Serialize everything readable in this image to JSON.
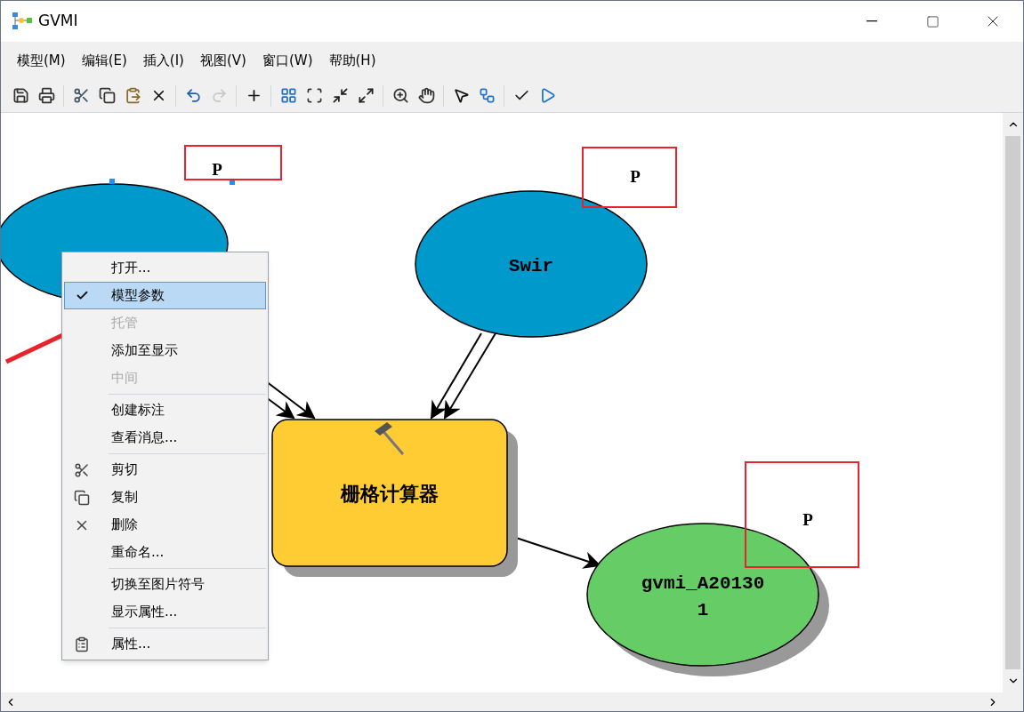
{
  "window": {
    "title": "GVMI"
  },
  "menu": [
    "模型(M)",
    "编辑(E)",
    "插入(I)",
    "视图(V)",
    "窗口(W)",
    "帮助(H)"
  ],
  "toolbar": [
    {
      "disabled": false
    },
    {
      "disabled": false
    },
    {
      "disabled": false
    },
    {
      "disabled": false
    },
    {
      "disabled": false
    },
    {
      "disabled": false
    },
    {
      "disabled": false
    },
    {
      "disabled": true
    },
    {
      "disabled": false
    },
    {
      "disabled": false
    },
    {
      "disabled": false
    },
    {
      "disabled": false
    },
    {
      "disabled": false
    },
    {
      "disabled": false
    },
    {
      "disabled": false
    },
    {
      "disabled": false
    },
    {
      "disabled": false
    },
    {
      "disabled": false
    },
    {
      "disabled": false
    }
  ],
  "nodes": [
    {
      "kind": "variable",
      "selected": true
    },
    {
      "kind": "variable",
      "lines": [
        "Swir"
      ],
      "selected": false
    },
    {
      "kind": "tool",
      "lines": [
        "栅格计算器"
      ],
      "selected": false
    },
    {
      "kind": "output",
      "lines": [
        "gvmi_A20130",
        "1"
      ],
      "selected": false
    }
  ],
  "parameter_marks": [
    "P",
    "P",
    "P"
  ],
  "context_menu": [
    [
      {
        "label": "打开...",
        "checked": false,
        "disabled": false,
        "selected": false
      },
      {
        "label": "模型参数",
        "checked": true,
        "disabled": false,
        "selected": true
      },
      {
        "label": "托管",
        "checked": false,
        "disabled": true,
        "selected": false
      },
      {
        "label": "添加至显示",
        "checked": false,
        "disabled": false,
        "selected": false
      },
      {
        "label": "中间",
        "checked": false,
        "disabled": true,
        "selected": false
      }
    ],
    [
      {
        "label": "创建标注",
        "checked": false,
        "disabled": false,
        "selected": false
      },
      {
        "label": "查看消息...",
        "checked": false,
        "disabled": false,
        "selected": false
      }
    ],
    [
      {
        "label": "剪切",
        "checked": false,
        "disabled": false,
        "selected": false
      },
      {
        "label": "复制",
        "checked": false,
        "disabled": false,
        "selected": false
      },
      {
        "label": "删除",
        "checked": false,
        "disabled": false,
        "selected": false
      },
      {
        "label": "重命名...",
        "checked": false,
        "disabled": false,
        "selected": false
      }
    ],
    [
      {
        "label": "切换至图片符号",
        "checked": false,
        "disabled": false,
        "selected": false
      },
      {
        "label": "显示属性...",
        "checked": false,
        "disabled": false,
        "selected": false
      }
    ],
    [
      {
        "label": "属性...",
        "checked": false,
        "disabled": false,
        "selected": false
      }
    ]
  ]
}
